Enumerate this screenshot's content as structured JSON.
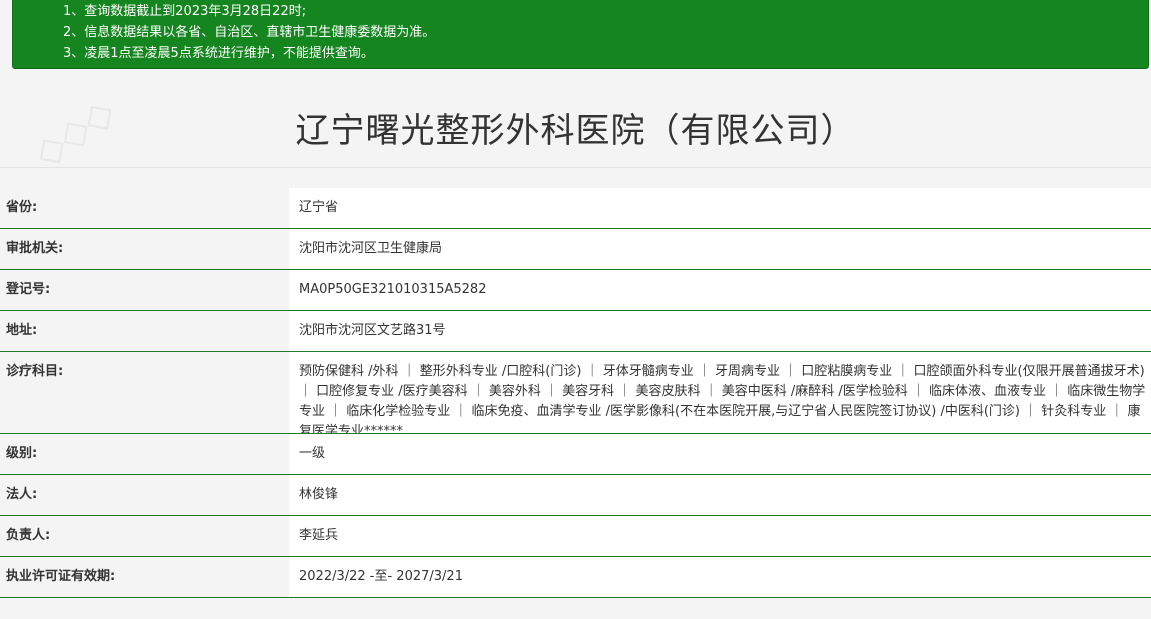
{
  "notice": {
    "lines": [
      "1、查询数据截止到2023年3月28日22时;",
      "2、信息数据结果以各省、自治区、直辖市卫生健康委数据为准。",
      "3、凌晨1点至凌晨5点系统进行维护，不能提供查询。"
    ]
  },
  "title": "辽宁曙光整形外科医院（有限公司）",
  "rows": [
    {
      "label": "省份:",
      "value": "辽宁省"
    },
    {
      "label": "审批机关:",
      "value": "沈阳市沈河区卫生健康局"
    },
    {
      "label": "登记号:",
      "value": "MA0P50GE321010315A5282"
    },
    {
      "label": "地址:",
      "value": "沈阳市沈河区文艺路31号"
    },
    {
      "label": "诊疗科目:",
      "value": "预防保健科 /外科 ｜ 整形外科专业 /口腔科(门诊) ｜ 牙体牙髓病专业 ｜ 牙周病专业 ｜ 口腔粘膜病专业 ｜ 口腔颌面外科专业(仅限开展普通拔牙术) ｜ 口腔修复专业 /医疗美容科 ｜ 美容外科 ｜ 美容牙科 ｜ 美容皮肤科 ｜ 美容中医科 /麻醉科 /医学检验科 ｜ 临床体液、血液专业 ｜ 临床微生物学专业 ｜ 临床化学检验专业 ｜ 临床免疫、血清学专业 /医学影像科(不在本医院开展,与辽宁省人民医院签订协议) /中医科(门诊) ｜ 针灸科专业 ｜ 康复医学专业******"
    },
    {
      "label": "级别:",
      "value": "一级"
    },
    {
      "label": "法人:",
      "value": "林俊锋"
    },
    {
      "label": "负责人:",
      "value": "李延兵"
    },
    {
      "label": "执业许可证有效期:",
      "value": "2022/3/22 -至- 2027/3/21"
    }
  ]
}
